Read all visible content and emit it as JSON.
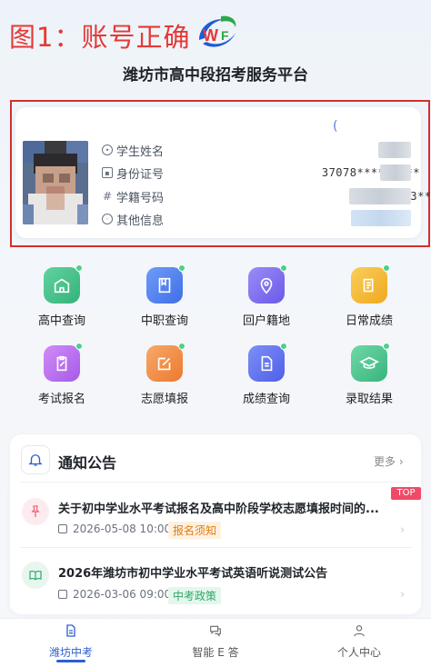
{
  "annotation": {
    "label": "图1：账号正确",
    "color": "#e53935"
  },
  "header": {
    "title": "潍坊市高中段招考服务平台",
    "logo_icon": "wf-logo-icon"
  },
  "profile": {
    "paren_text": "(",
    "fields": [
      {
        "label": "学生姓名",
        "icon": "user-circle-icon",
        "value": ""
      },
      {
        "label": "身份证号",
        "icon": "id-card-icon",
        "value": "37078*********"
      },
      {
        "label": "学籍号码",
        "icon": "hash-icon",
        "value": "20233****"
      },
      {
        "label": "其他信息",
        "icon": "info-circle-icon",
        "value": ""
      }
    ]
  },
  "services": [
    {
      "label": "高中查询",
      "icon": "school-icon",
      "color": "#3fbf88"
    },
    {
      "label": "中职查询",
      "icon": "book-icon",
      "color": "#4f7ff0"
    },
    {
      "label": "回户籍地",
      "icon": "location-icon",
      "color": "#7b6cf0"
    },
    {
      "label": "日常成绩",
      "icon": "scroll-icon",
      "color": "#f5b82e"
    },
    {
      "label": "考试报名",
      "icon": "clipboard-edit-icon",
      "color": "#b86cf0"
    },
    {
      "label": "志愿填报",
      "icon": "edit-square-icon",
      "color": "#f08a3c"
    },
    {
      "label": "成绩查询",
      "icon": "document-icon",
      "color": "#5a6ff0"
    },
    {
      "label": "录取结果",
      "icon": "graduation-cap-icon",
      "color": "#3fbf88"
    }
  ],
  "notices": {
    "title": "通知公告",
    "more": "更多 ›",
    "items": [
      {
        "headline": "关于初中学业水平考试报名及高中阶段学校志愿填报时间的...",
        "date": "2026-05-08 10:00",
        "tag": "报名须知",
        "badge": "TOP",
        "icon": "pin-icon"
      },
      {
        "headline": "2026年潍坊市初中学业水平考试英语听说测试公告",
        "date": "2026-03-06 09:00",
        "tag": "中考政策",
        "icon": "open-book-icon"
      }
    ]
  },
  "tabbar": [
    {
      "label": "潍坊中考",
      "icon": "file-icon",
      "active": true
    },
    {
      "label": "智能 E 答",
      "icon": "chat-icon",
      "active": false
    },
    {
      "label": "个人中心",
      "icon": "person-icon",
      "active": false
    }
  ]
}
